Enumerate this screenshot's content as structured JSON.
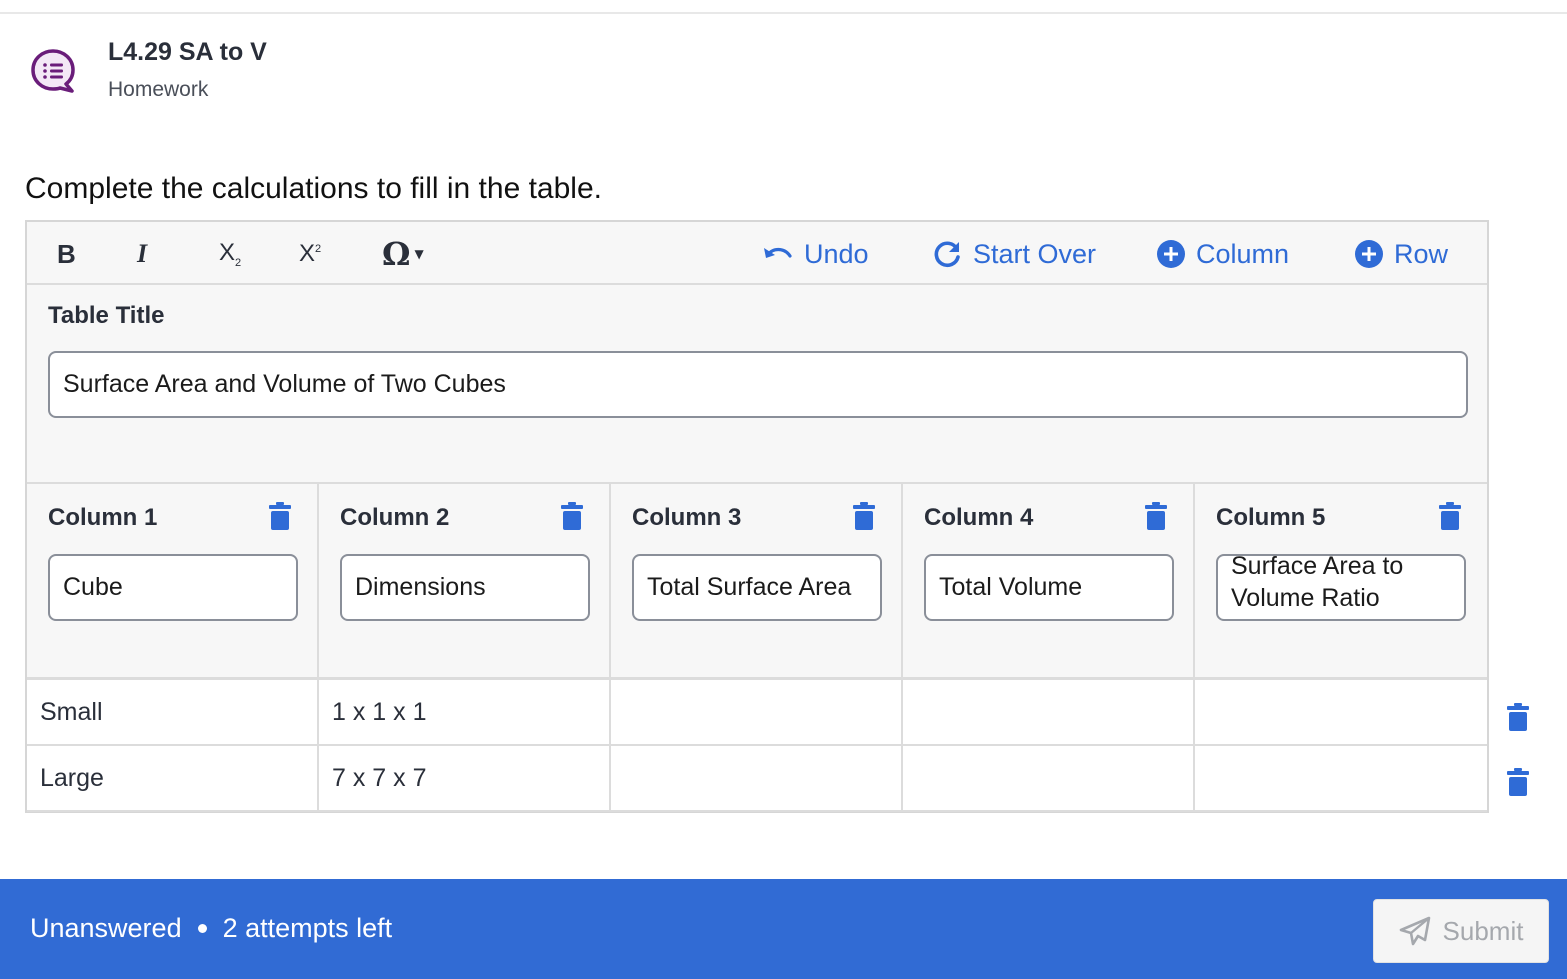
{
  "assignment": {
    "title": "L4.29 SA to V",
    "subtitle": "Homework",
    "icon": "chat-list-icon",
    "icon_color": "#6a1d7a"
  },
  "prompt": "Complete the calculations to fill in the table.",
  "toolbar": {
    "bold": "B",
    "italic": "I",
    "subscript": "X",
    "superscript": "X",
    "omega": "Ω",
    "undo": "Undo",
    "start_over": "Start Over",
    "add_column": "Column",
    "add_row": "Row",
    "accent_color": "#2f6bd6"
  },
  "table": {
    "title_label": "Table Title",
    "title_value": "Surface Area and Volume of Two Cubes",
    "columns": [
      {
        "name": "Column 1",
        "header": "Cube"
      },
      {
        "name": "Column 2",
        "header": "Dimensions"
      },
      {
        "name": "Column 3",
        "header": "Total Surface Area"
      },
      {
        "name": "Column 4",
        "header": "Total Volume"
      },
      {
        "name": "Column 5",
        "header": "Surface Area to Volume Ratio"
      }
    ],
    "rows": [
      [
        "Small",
        "1 x 1 x 1",
        "",
        "",
        ""
      ],
      [
        "Large",
        "7 x 7 x 7",
        "",
        "",
        ""
      ]
    ]
  },
  "footer": {
    "status": "Unanswered",
    "attempts": "2 attempts left",
    "submit": "Submit",
    "bg_color": "#316bd4"
  }
}
